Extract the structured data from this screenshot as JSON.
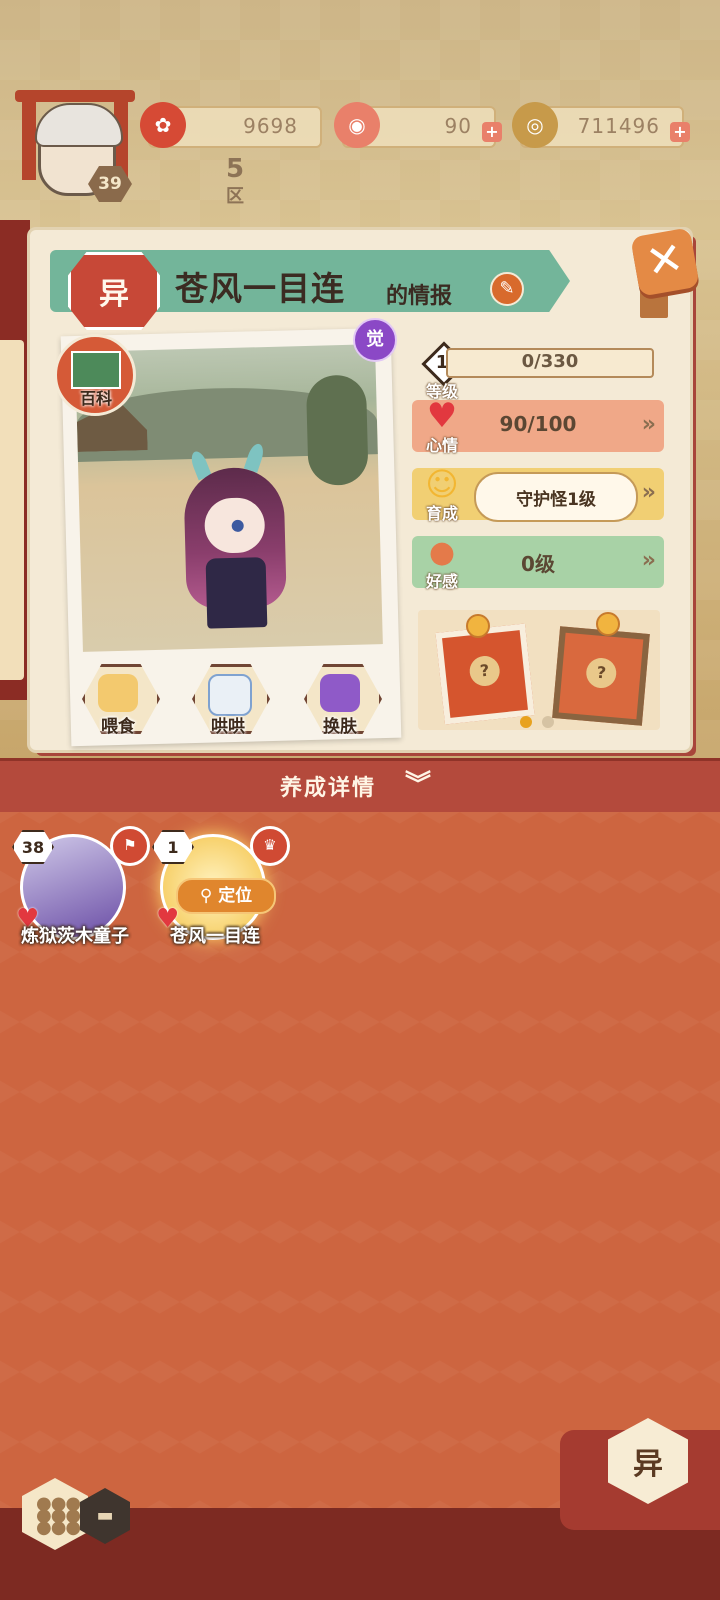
{
  "currencies": {
    "coin_flower": {
      "value": "9698"
    },
    "stamina": {
      "value": "90"
    },
    "gold": {
      "value": "711496"
    }
  },
  "player": {
    "level": "39",
    "district": "5\n区"
  },
  "panel": {
    "type_badge": "异",
    "title": "苍风一目连",
    "title_suffix": "的情报",
    "awaken_badge": "觉",
    "wiki_label": "百科",
    "actions": [
      {
        "label": "喂食"
      },
      {
        "label": "哄哄"
      },
      {
        "label": "换肤"
      }
    ]
  },
  "stats": {
    "level": {
      "badge": "1",
      "label": "等级",
      "value": "0/330"
    },
    "mood": {
      "label": "心情",
      "value": "90/100"
    },
    "growth": {
      "label": "育成",
      "value": "守护怪1级"
    },
    "affinity": {
      "label": "好感",
      "value": "0级"
    }
  },
  "carousel": {
    "gift1": "?",
    "gift2": "?"
  },
  "detail": {
    "label": "养成详情"
  },
  "cards": [
    {
      "level": "38",
      "name": "炼狱茨木童子"
    },
    {
      "level": "1",
      "name": "苍风一目连",
      "locate": "定位"
    }
  ],
  "bottom": {
    "filter_label": "异"
  },
  "colors": {
    "accent_red": "#c74837",
    "bottom_bg": "#cd6540",
    "mood_bar": "#f0a888",
    "growth_bar": "#f1cf73",
    "affinity_bar": "#a8d2a6",
    "header_green": "#73b59a"
  },
  "icons": [
    "close-icon",
    "edit-icon",
    "heart-icon",
    "chevron-right-icon",
    "double-chevron-down-icon",
    "grid-view-icon",
    "list-view-icon",
    "location-pin-icon"
  ]
}
